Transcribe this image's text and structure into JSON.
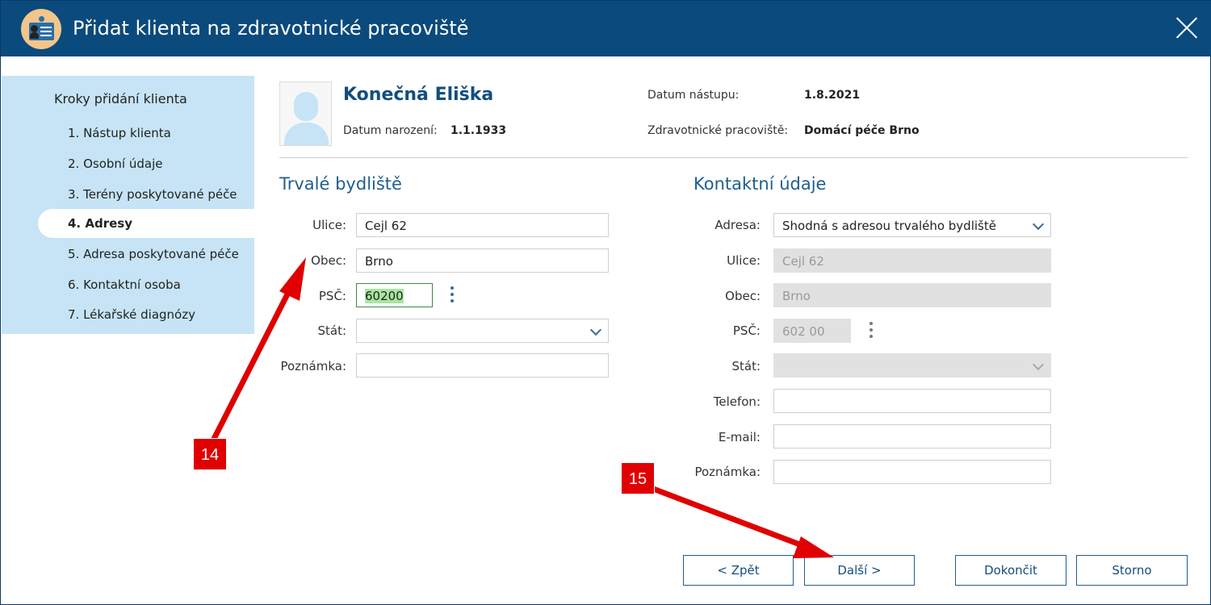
{
  "window": {
    "title": "Přidat klienta na zdravotnické pracoviště"
  },
  "steps": {
    "title": "Kroky přidání klienta",
    "items": [
      {
        "label": "1. Nástup klienta"
      },
      {
        "label": "2. Osobní údaje"
      },
      {
        "label": "3. Terény poskytované péče"
      },
      {
        "label": "4. Adresy",
        "active": true
      },
      {
        "label": "5. Adresa poskytované péče"
      },
      {
        "label": "6. Kontaktní osoba"
      },
      {
        "label": "7. Lékařské diagnózy"
      }
    ]
  },
  "client": {
    "name": "Konečná Eliška",
    "birth_label": "Datum narození:",
    "birth_value": "1.1.1933",
    "start_label": "Datum nástupu:",
    "start_value": "1.8.2021",
    "workplace_label": "Zdravotnické pracoviště:",
    "workplace_value": "Domácí péče Brno"
  },
  "permanent": {
    "title": "Trvalé bydliště",
    "street_label": "Ulice:",
    "street_value": "Cejl 62",
    "city_label": "Obec:",
    "city_value": "Brno",
    "zip_label": "PSČ:",
    "zip_value": "60200",
    "country_label": "Stát:",
    "country_value": "",
    "note_label": "Poznámka:",
    "note_value": ""
  },
  "contact": {
    "title": "Kontaktní údaje",
    "address_label": "Adresa:",
    "address_value": "Shodná s adresou trvalého bydliště",
    "street_label": "Ulice:",
    "street_value": "Cejl 62",
    "city_label": "Obec:",
    "city_value": "Brno",
    "zip_label": "PSČ:",
    "zip_value": "602 00",
    "country_label": "Stát:",
    "country_value": "",
    "phone_label": "Telefon:",
    "phone_value": "",
    "email_label": "E-mail:",
    "email_value": "",
    "note_label": "Poznámka:",
    "note_value": ""
  },
  "buttons": {
    "back": "< Zpět",
    "next": "Další >",
    "finish": "Dokončit",
    "cancel": "Storno"
  },
  "annotations": {
    "badge_14": "14",
    "badge_15": "15"
  },
  "colors": {
    "titlebar": "#0b4a7c",
    "steps_bg": "#c6e4f5",
    "accent": "#1f5e8e",
    "annotation": "#e00000"
  }
}
